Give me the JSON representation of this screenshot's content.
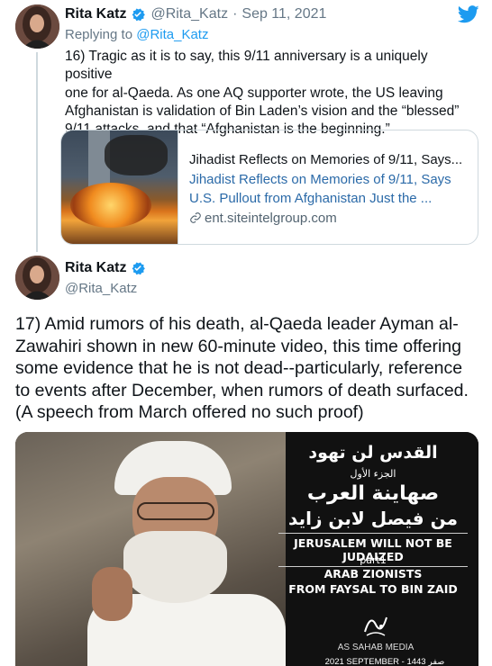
{
  "tweet1": {
    "name": "Rita Katz",
    "handle": "@Rita_Katz",
    "separator": "·",
    "date": "Sep 11, 2021",
    "replying_prefix": "Replying to ",
    "replying_to": "@Rita_Katz",
    "lines": [
      "16) Tragic as it is to say, this 9/11 anniversary is a uniquely positive",
      "one for al-Qaeda. As one AQ supporter wrote, the US leaving",
      "Afghanistan is validation of Bin Laden’s vision and the “blessed”",
      "9/11 attacks, and that “Afghanistan is the beginning.”"
    ],
    "card": {
      "title": "Jihadist Reflects on Memories of 9/11, Says...",
      "desc_line1": "Jihadist Reflects on Memories of 9/11, Says",
      "desc_line2": "U.S. Pullout from Afghanistan Just the ...",
      "domain": "ent.siteintelgroup.com"
    }
  },
  "tweet2": {
    "name": "Rita Katz",
    "handle": "@Rita_Katz",
    "lines": [
      "17) Amid rumors of his death, al-Qaeda leader Ayman al-",
      "Zawahiri shown in new 60-minute video, this time offering",
      "some evidence that he is not dead--particularly, reference",
      "to events after December, when rumors of death surfaced.",
      "(A speech from March offered no such proof)"
    ],
    "media": {
      "ar_title": "القدس لن تهود",
      "ar_part": "الجزء الأول",
      "ar_line1": "صهاينة العرب",
      "ar_line2": "من فيصل لابن زايد",
      "en_title": "JERUSALEM WILL NOT BE JUDAIZED",
      "en_part": "part1",
      "en_line1": "ARAB ZIONISTS",
      "en_line2": "FROM FAYSAL TO BIN ZAID",
      "producer": "AS SAHAB MEDIA",
      "date": "2021 SEPTEMBER - 1443 صفر"
    }
  },
  "colors": {
    "brand_blue": "#1d9bf0",
    "muted": "#657786",
    "border": "#cfd9de"
  },
  "icons": {
    "logo": "twitter-bird-icon",
    "verified": "verified-badge-icon",
    "link": "link-icon"
  }
}
